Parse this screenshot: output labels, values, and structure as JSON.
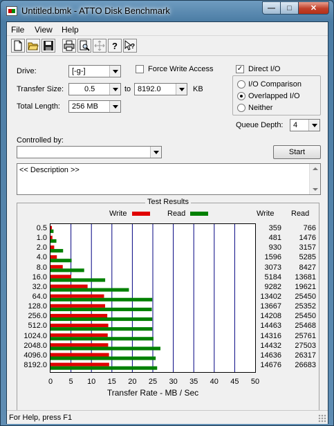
{
  "window": {
    "title": "Untitled.bmk - ATTO Disk Benchmark"
  },
  "menu": [
    "File",
    "View",
    "Help"
  ],
  "toolbar": [
    "new-file-icon",
    "open-folder-icon",
    "save-disk-icon",
    "print-icon",
    "print-preview-icon",
    "move-cross-icon",
    "help-question-icon",
    "context-help-icon"
  ],
  "form": {
    "drive_label": "Drive:",
    "drive_value": "[-g-]",
    "force_write_label": "Force Write Access",
    "force_write_checked": false,
    "direct_io_label": "Direct I/O",
    "direct_io_checked": true,
    "transfer_size_label": "Transfer Size:",
    "transfer_from": "0.5",
    "to_label": "to",
    "transfer_to": "8192.0",
    "kb_label": "KB",
    "total_length_label": "Total Length:",
    "total_length_value": "256 MB",
    "io_comparison_label": "I/O Comparison",
    "overlapped_io_label": "Overlapped I/O",
    "neither_label": "Neither",
    "selected_mode": "Overlapped I/O",
    "queue_depth_label": "Queue Depth:",
    "queue_depth_value": "4",
    "controlled_by_label": "Controlled by:",
    "controlled_by_value": "",
    "start_label": "Start",
    "description": "<< Description >>"
  },
  "results": {
    "title": "Test Results",
    "write_legend": "Write",
    "read_legend": "Read",
    "write_col": "Write",
    "read_col": "Read",
    "xlabel": "Transfer Rate - MB / Sec",
    "write_color": "#e00000",
    "read_color": "#008000"
  },
  "chart_data": {
    "type": "bar",
    "orientation": "horizontal",
    "categories": [
      "0.5",
      "1.0",
      "2.0",
      "4.0",
      "8.0",
      "16.0",
      "32.0",
      "64.0",
      "128.0",
      "256.0",
      "512.0",
      "1024.0",
      "2048.0",
      "4096.0",
      "8192.0"
    ],
    "series": [
      {
        "name": "Write",
        "values": [
          359,
          481,
          930,
          1596,
          3073,
          5184,
          9282,
          13402,
          13667,
          14208,
          14463,
          14316,
          14432,
          14636,
          14676
        ]
      },
      {
        "name": "Read",
        "values": [
          766,
          1476,
          3157,
          5285,
          8427,
          13681,
          19621,
          25450,
          25352,
          25450,
          25468,
          25761,
          27503,
          26317,
          26683
        ]
      }
    ],
    "xticks": [
      "0",
      "5",
      "10",
      "15",
      "20",
      "25",
      "30",
      "35",
      "40",
      "45",
      "50"
    ],
    "xlim": [
      0,
      50
    ],
    "xlabel": "Transfer Rate - MB / Sec",
    "grid": true,
    "legend": "top-center"
  },
  "status": {
    "text": "For Help, press F1"
  }
}
